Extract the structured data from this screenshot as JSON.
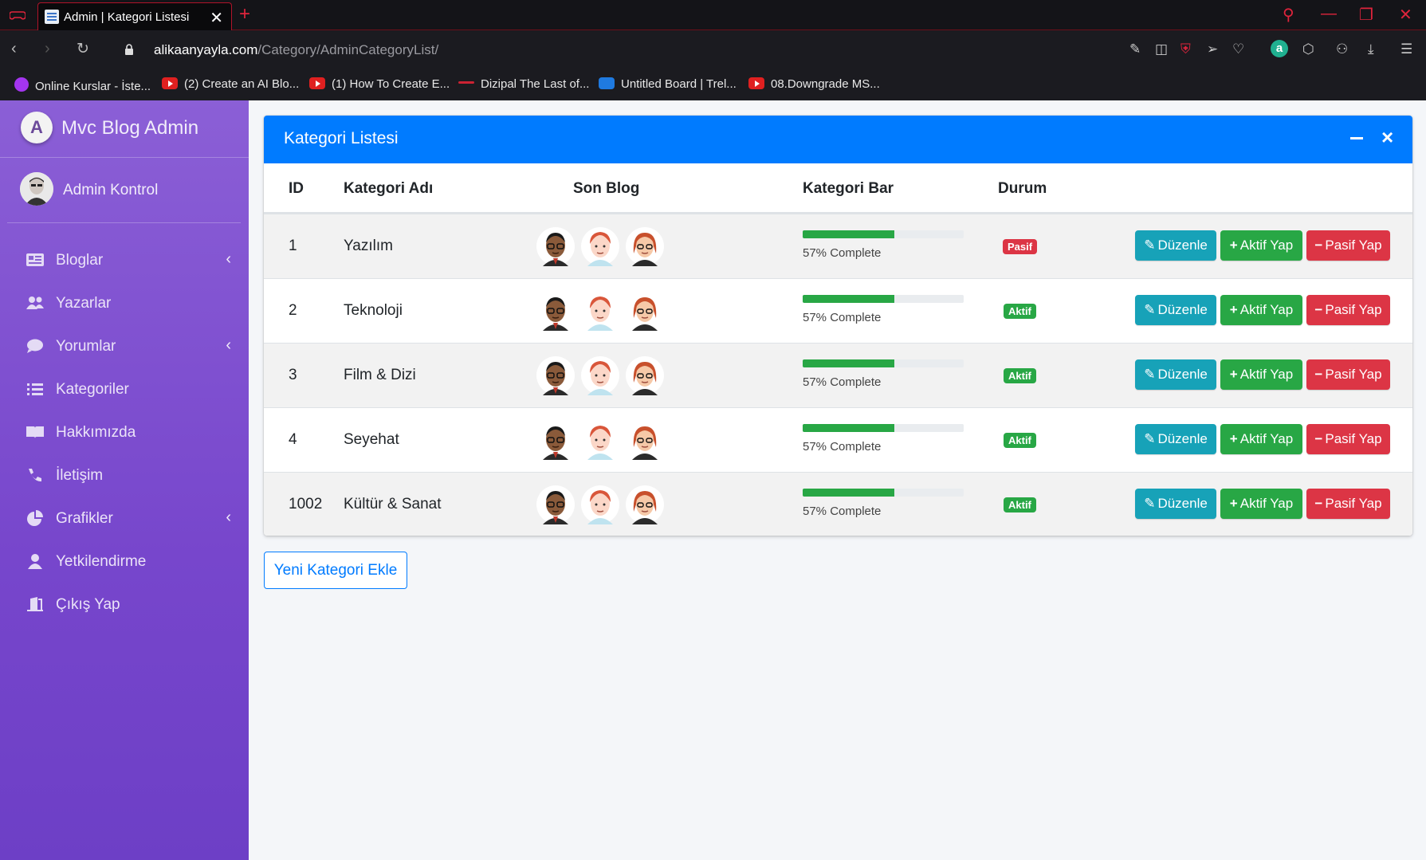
{
  "browser": {
    "tab_title": "Admin | Kategori Listesi",
    "url_domain": "alikaanyayla.com",
    "url_path": "/Category/AdminCategoryList/",
    "bookmarks": [
      {
        "label": "Online Kurslar - İste...",
        "icon": "udemy-icon"
      },
      {
        "label": "(2) Create an AI Blo...",
        "icon": "youtube-icon"
      },
      {
        "label": "(1) How To Create E...",
        "icon": "youtube-icon"
      },
      {
        "label": "Dizipal The Last of...",
        "icon": "dizipal-icon"
      },
      {
        "label": "Untitled Board | Trel...",
        "icon": "trello-icon"
      },
      {
        "label": "08.Downgrade MS...",
        "icon": "youtube-icon"
      }
    ]
  },
  "sidebar": {
    "brand": "Mvc Blog Admin",
    "user": "Admin Kontrol",
    "items": [
      {
        "label": "Bloglar",
        "icon": "newspaper-icon",
        "has_arrow": true
      },
      {
        "label": "Yazarlar",
        "icon": "users-icon",
        "has_arrow": false
      },
      {
        "label": "Yorumlar",
        "icon": "comment-icon",
        "has_arrow": true
      },
      {
        "label": "Kategoriler",
        "icon": "list-icon",
        "has_arrow": false
      },
      {
        "label": "Hakkımızda",
        "icon": "book-icon",
        "has_arrow": false
      },
      {
        "label": "İletişim",
        "icon": "phone-icon",
        "has_arrow": false
      },
      {
        "label": "Grafikler",
        "icon": "pie-chart-icon",
        "has_arrow": true
      },
      {
        "label": "Yetkilendirme",
        "icon": "user-shield-icon",
        "has_arrow": false
      },
      {
        "label": "Çıkış Yap",
        "icon": "door-exit-icon",
        "has_arrow": false
      }
    ]
  },
  "card": {
    "title": "Kategori Listesi",
    "columns": [
      "ID",
      "Kategori Adı",
      "Son Blog",
      "Kategori Bar",
      "Durum"
    ],
    "rows": [
      {
        "id": "1",
        "name": "Yazılım",
        "progress": 57,
        "progress_text": "57% Complete",
        "status": "Pasif"
      },
      {
        "id": "2",
        "name": "Teknoloji",
        "progress": 57,
        "progress_text": "57% Complete",
        "status": "Aktif"
      },
      {
        "id": "3",
        "name": "Film & Dizi",
        "progress": 57,
        "progress_text": "57% Complete",
        "status": "Aktif"
      },
      {
        "id": "4",
        "name": "Seyehat",
        "progress": 57,
        "progress_text": "57% Complete",
        "status": "Aktif"
      },
      {
        "id": "1002",
        "name": "Kültür & Sanat",
        "progress": 57,
        "progress_text": "57% Complete",
        "status": "Aktif"
      }
    ],
    "buttons": {
      "edit": "Düzenle",
      "activate": "Aktif Yap",
      "deactivate": "Pasif Yap"
    }
  },
  "new_category_button": "Yeni Kategori Ekle",
  "colors": {
    "primary": "#007bff",
    "success": "#28a745",
    "danger": "#dc3545",
    "info": "#17a2b8",
    "sidebar_top": "#8b5fd6",
    "sidebar_bottom": "#6d3fc6"
  }
}
